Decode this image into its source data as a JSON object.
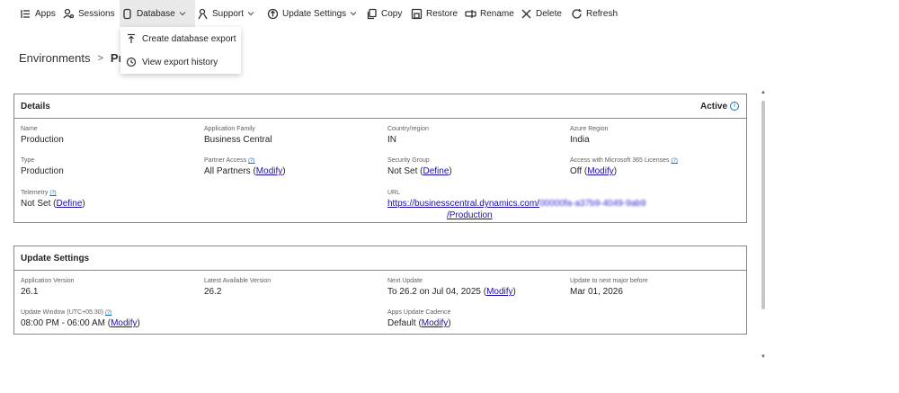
{
  "toolbar": {
    "items": [
      {
        "label": "Apps",
        "icon": "apps-list-icon"
      },
      {
        "label": "Sessions",
        "icon": "sessions-icon"
      },
      {
        "label": "Database",
        "icon": "database-icon"
      },
      {
        "label": "Support",
        "icon": "support-icon"
      },
      {
        "label": "Update Settings",
        "icon": "update-settings-icon"
      },
      {
        "label": "Copy",
        "icon": "copy-icon"
      },
      {
        "label": "Restore",
        "icon": "restore-icon"
      },
      {
        "label": "Rename",
        "icon": "rename-icon"
      },
      {
        "label": "Delete",
        "icon": "delete-icon"
      },
      {
        "label": "Refresh",
        "icon": "refresh-icon"
      }
    ]
  },
  "database_menu": {
    "items": [
      {
        "label": "Create database export",
        "icon": "export-up-icon"
      },
      {
        "label": "View export history",
        "icon": "history-icon"
      }
    ]
  },
  "breadcrumb": {
    "root": "Environments",
    "current": "Pro"
  },
  "details": {
    "title": "Details",
    "status": "Active",
    "fields": {
      "name": {
        "label": "Name",
        "value": "Production"
      },
      "app_family": {
        "label": "Application Family",
        "value": "Business Central"
      },
      "country": {
        "label": "Country/region",
        "value": "IN"
      },
      "azure_region": {
        "label": "Azure Region",
        "value": "India"
      },
      "type": {
        "label": "Type",
        "value": "Production"
      },
      "partner_access": {
        "label": "Partner Access",
        "help": "(?)",
        "value": "All Partners (",
        "link": "Modify",
        "suffix": ")"
      },
      "security_group": {
        "label": "Security Group",
        "value": "Not Set (",
        "link": "Define",
        "suffix": ")"
      },
      "m365_access": {
        "label": "Access with Microsoft 365 Licenses",
        "help": "(?)",
        "value": "Off (",
        "link": "Modify",
        "suffix": ")"
      },
      "telemetry": {
        "label": "Telemetry",
        "help": "(?)",
        "value": "Not Set (",
        "link": "Define",
        "suffix": ")"
      },
      "url": {
        "label": "URL",
        "link": "https://businesscentral.dynamics.com/",
        "blurred": "00000fa-a37b9-4049-9ab9",
        "line2": "/Production"
      }
    }
  },
  "update_settings": {
    "title": "Update Settings",
    "fields": {
      "app_version": {
        "label": "Application Version",
        "value": "26.1"
      },
      "latest_version": {
        "label": "Latest Available Version",
        "value": "26.2"
      },
      "next_update": {
        "label": "Next Update",
        "value": "To 26.2 on Jul 04, 2025 (",
        "link": "Modify",
        "suffix": ")"
      },
      "next_major": {
        "label": "Update to next major before",
        "value": "Mar 01, 2026"
      },
      "update_window": {
        "label": "Update Window (UTC+05:30)",
        "help": "(?)",
        "value": "08:00 PM - 06:00 AM (",
        "link": "Modify",
        "suffix": ")"
      },
      "apps_cadence": {
        "label": "Apps Update Cadence",
        "value": "Default (",
        "link": "Modify",
        "suffix": ")"
      }
    }
  },
  "colors": {
    "link": "#1a0dab",
    "help": "#0f6cbd",
    "border": "#8a8886",
    "active_toolbar_bg": "#e9e9e9"
  }
}
